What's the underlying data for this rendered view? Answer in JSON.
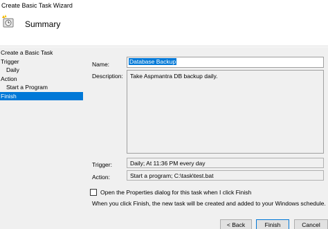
{
  "window": {
    "title": "Create Basic Task Wizard"
  },
  "header": {
    "page_title": "Summary",
    "icon": "task-scheduler-wizard-icon"
  },
  "nav": {
    "items": [
      {
        "label": "Create a Basic Task"
      },
      {
        "label": "Trigger"
      },
      {
        "label": "Daily"
      },
      {
        "label": "Action"
      },
      {
        "label": "Start a Program"
      },
      {
        "label": "Finish",
        "selected": true
      }
    ]
  },
  "form": {
    "name_label": "Name:",
    "name_value": "Database Backup",
    "description_label": "Description:",
    "description_value": "Take Aspmantra DB backup daily.",
    "trigger_label": "Trigger:",
    "trigger_value": "Daily; At 11:36 PM every day",
    "action_label": "Action:",
    "action_value": "Start a program; C:\\task\\test.bat",
    "open_properties_label": "Open the Properties dialog for this task when I click Finish",
    "open_properties_checked": false,
    "info_text": "When you click Finish, the new task will be created and added to your Windows schedule."
  },
  "buttons": {
    "back": "< Back",
    "finish": "Finish",
    "cancel": "Cancel"
  },
  "colors": {
    "selection": "#0078d7",
    "panel": "#f0f0f0"
  }
}
